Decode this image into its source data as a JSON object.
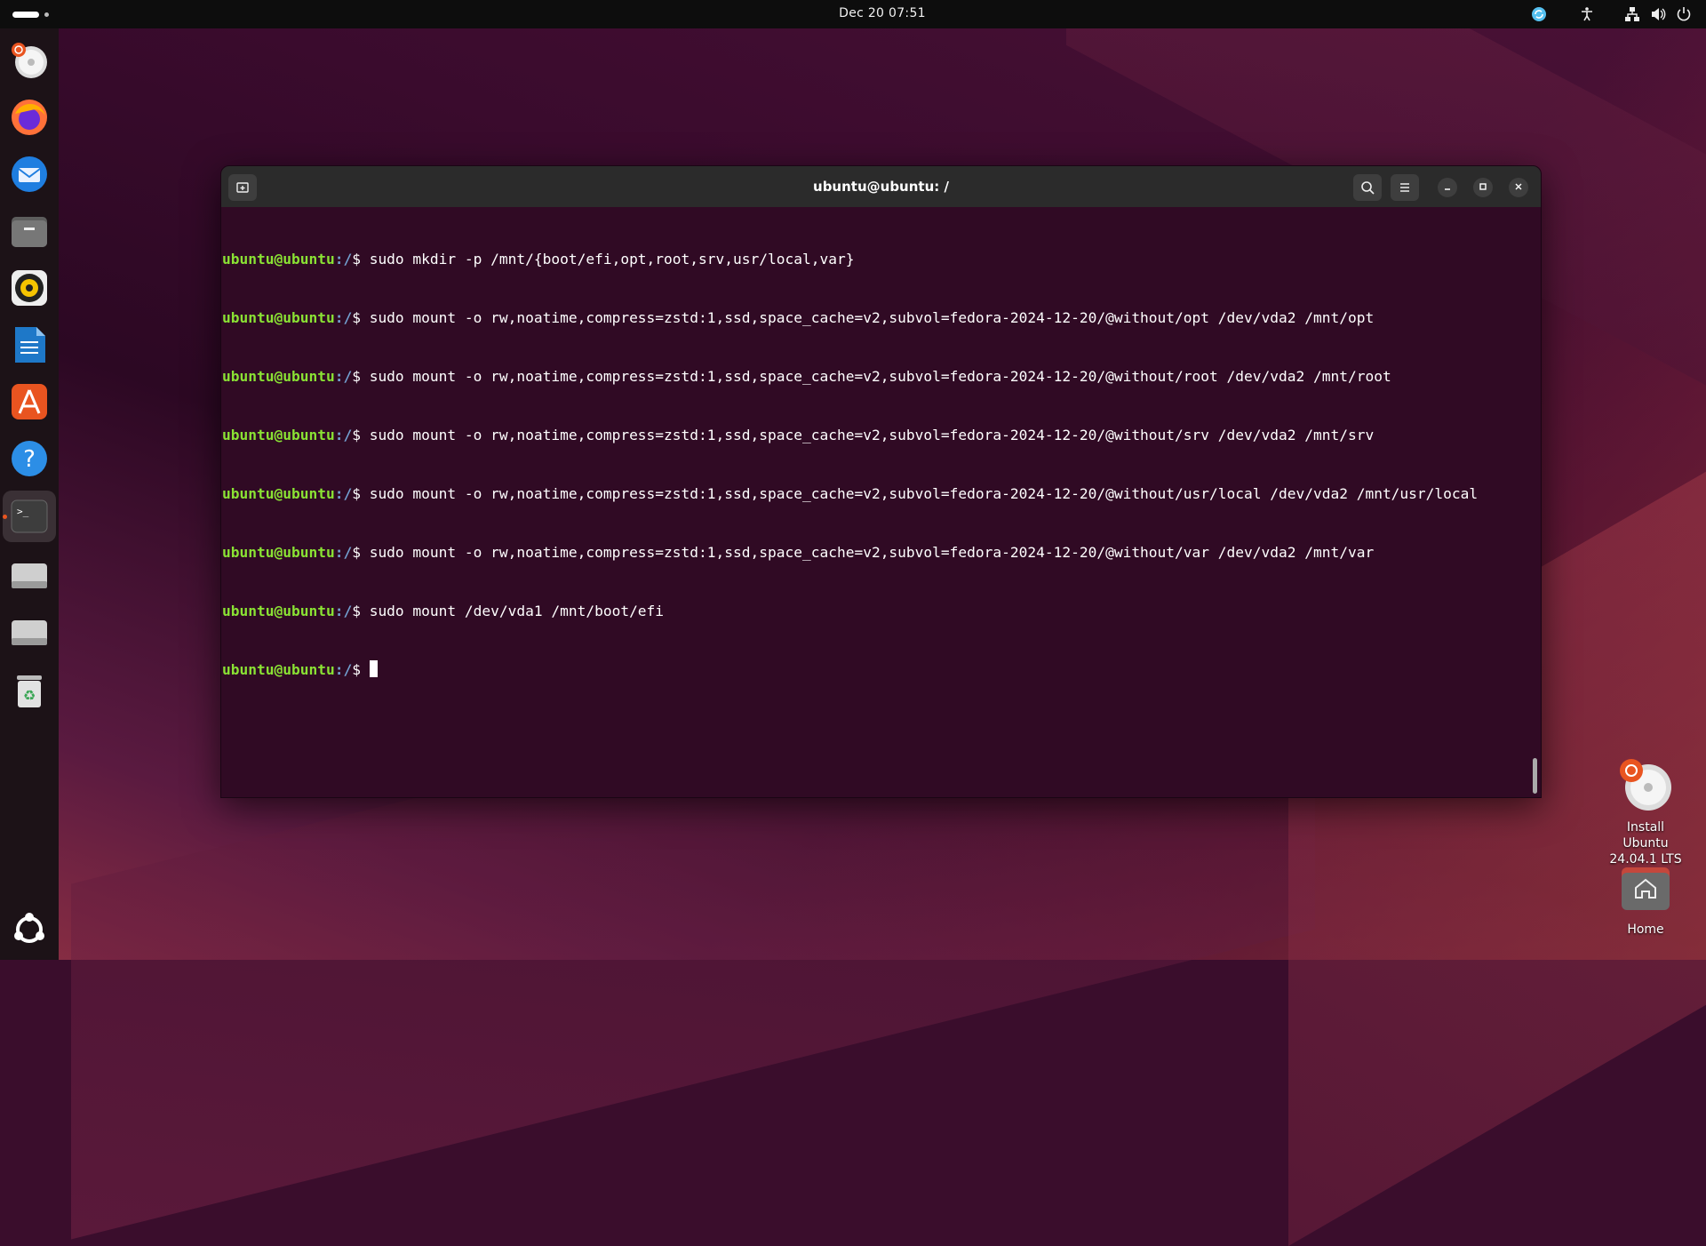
{
  "topbar": {
    "clock": "Dec 20  07:51",
    "tray_icons": [
      "update-icon",
      "accessibility-icon",
      "network-icon",
      "volume-icon",
      "power-icon"
    ]
  },
  "dock": {
    "items": [
      {
        "name": "installer-icon"
      },
      {
        "name": "firefox-icon"
      },
      {
        "name": "thunderbird-icon"
      },
      {
        "name": "files-icon"
      },
      {
        "name": "rhythmbox-icon"
      },
      {
        "name": "writer-icon"
      },
      {
        "name": "app-center-icon"
      },
      {
        "name": "help-icon"
      },
      {
        "name": "terminal-icon"
      },
      {
        "name": "drive-icon"
      },
      {
        "name": "drive-icon-2"
      },
      {
        "name": "trash-icon"
      }
    ],
    "apps_grid": "show-apps-icon"
  },
  "terminal": {
    "title": "ubuntu@ubuntu: /",
    "lines": [
      {
        "user": "ubuntu@ubuntu",
        "path": ":/",
        "cmd": "$ sudo mkdir -p /mnt/{boot/efi,opt,root,srv,usr/local,var}"
      },
      {
        "user": "ubuntu@ubuntu",
        "path": ":/",
        "cmd": "$ sudo mount -o rw,noatime,compress=zstd:1,ssd,space_cache=v2,subvol=fedora-2024-12-20/@without/opt /dev/vda2 /mnt/opt"
      },
      {
        "user": "ubuntu@ubuntu",
        "path": ":/",
        "cmd": "$ sudo mount -o rw,noatime,compress=zstd:1,ssd,space_cache=v2,subvol=fedora-2024-12-20/@without/root /dev/vda2 /mnt/root"
      },
      {
        "user": "ubuntu@ubuntu",
        "path": ":/",
        "cmd": "$ sudo mount -o rw,noatime,compress=zstd:1,ssd,space_cache=v2,subvol=fedora-2024-12-20/@without/srv /dev/vda2 /mnt/srv"
      },
      {
        "user": "ubuntu@ubuntu",
        "path": ":/",
        "cmd": "$ sudo mount -o rw,noatime,compress=zstd:1,ssd,space_cache=v2,subvol=fedora-2024-12-20/@without/usr/local /dev/vda2 /mnt/usr/local"
      },
      {
        "user": "ubuntu@ubuntu",
        "path": ":/",
        "cmd": "$ sudo mount -o rw,noatime,compress=zstd:1,ssd,space_cache=v2,subvol=fedora-2024-12-20/@without/var /dev/vda2 /mnt/var"
      },
      {
        "user": "ubuntu@ubuntu",
        "path": ":/",
        "cmd": "$ sudo mount /dev/vda1 /mnt/boot/efi"
      },
      {
        "user": "ubuntu@ubuntu",
        "path": ":/",
        "cmd": "$ "
      }
    ]
  },
  "desktop": {
    "install_label": "Install Ubuntu 24.04.1 LTS",
    "home_label": "Home"
  },
  "colors": {
    "prompt_user": "#8ae234",
    "prompt_path": "#729fcf",
    "terminal_bg": "#300a24",
    "accent": "#e95420"
  }
}
